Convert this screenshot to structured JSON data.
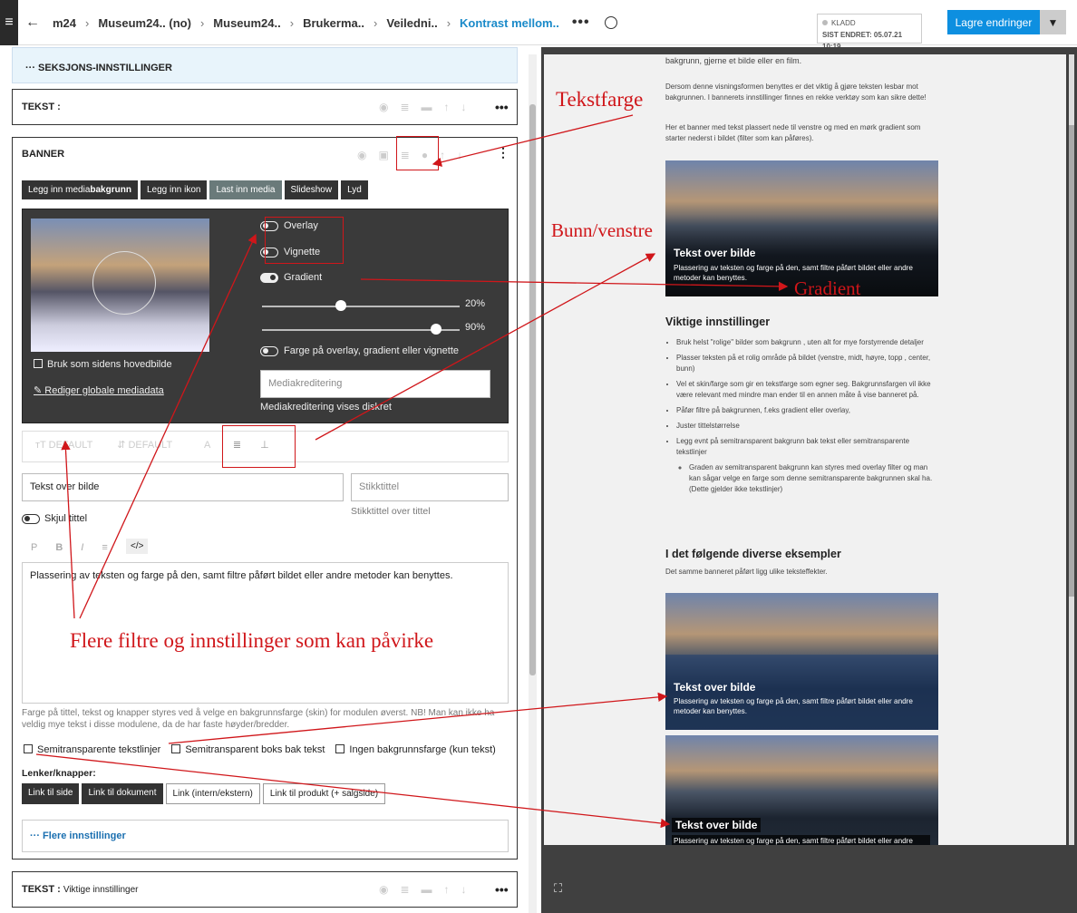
{
  "topbar": {
    "back": "←",
    "crumbs": [
      "m24",
      "Museum24.. (no)",
      "Museum24..",
      "Brukerma..",
      "Veiledni..",
      "Kontrast mellom.."
    ],
    "status": "KLADD",
    "last_changed": "SIST ENDRET: 05.07.21 10:19",
    "save": "Lagre endringer"
  },
  "section_settings": "··· SEKSJONS-INNSTILLINGER",
  "card1": {
    "title": "TEKST :"
  },
  "banner": {
    "title": "BANNER",
    "tabs": [
      {
        "pre": "Legg inn media",
        "bold": "bakgrunn"
      },
      {
        "label": "Legg inn ikon"
      },
      {
        "label": "Last inn media"
      },
      {
        "label": "Slideshow"
      },
      {
        "label": "Lyd"
      }
    ],
    "overlay": "Overlay",
    "vignette": "Vignette",
    "gradient": "Gradient",
    "pct1": "20%",
    "pct2": "90%",
    "slider1": 0.4,
    "slider2": 0.88,
    "color_toggle": "Farge på overlay, gradient eller vignette",
    "main_image": "Bruk som sidens hovedbilde",
    "edit_media": "Rediger globale mediadata",
    "credit_placeholder": "Mediakreditering",
    "credit_note": "Mediakreditering vises diskret",
    "default1": "DEFAULT",
    "default2": "DEFAULT",
    "title_value": "Tekst over bilde",
    "kicker_placeholder": "Stikktittel",
    "kicker_note": "Stikktittel over tittel",
    "hide_title": "Skjul tittel",
    "body_text": "Plassering av teksten og farge på den, samt filtre påført bildet eller andre metoder kan benyttes.",
    "help": "Farge på tittel, tekst og knapper styres ved å velge en bakgrunnsfarge (skin) for modulen øverst. NB! Man kan ikke ha veldig mye tekst i disse modulene, da de har faste høyder/bredder.",
    "cb1": "Semitransparente tekstlinjer",
    "cb2": "Semitransparent boks bak tekst",
    "cb3": "Ingen bakgrunnsfarge (kun tekst)",
    "links_label": "Lenker/knapper:",
    "links": [
      "Link til side",
      "Link til dokument",
      "Link (intern/ekstern)",
      "Link til produkt (+ salgside)"
    ],
    "more_settings": "··· Flere innstillinger"
  },
  "card3": {
    "title": "TEKST :",
    "subtitle": "Viktige innstillinger"
  },
  "preview": {
    "p0": "bakgrunn, gjerne et bilde eller en film.",
    "p1": "Dersom denne visningsformen benyttes er det viktig å gjøre teksten lesbar mot bakgrunnen. I bannerets innstillinger finnes en rekke verktøy som kan sikre dette!",
    "p2": "Her et banner med tekst plassert nede til venstre og med en mørk gradient som starter nederst i bildet (filter som kan påføres).",
    "banner_title": "Tekst over bilde",
    "banner_text": "Plassering av teksten og farge på den, samt filtre påført bildet eller andre metoder kan benyttes.",
    "h1": "Viktige innstillinger",
    "list": [
      "Bruk helst \"rolige\" bilder som bakgrunn , uten alt for mye forstyrrende detaljer",
      "Plasser teksten på et rolig område på bildet (venstre, midt, høyre, topp , center, bunn)",
      "Vel et skin/farge som gir en tekstfarge som egner seg. Bakgrunnsfargen vil ikke være relevant med mindre man ender til en annen måte å vise banneret på.",
      "Påfør filtre på bakgrunnen, f.eks gradient eller overlay,",
      "Juster tittelstørrelse",
      "Legg evnt på semitransparent bakgrunn bak tekst eller semitransparente tekstlinjer"
    ],
    "sublist": "Graden av semitransparent bakgrunn kan styres med overlay filter og man kan sågar velge en farge som denne semitransparente bakgrunnen skal ha. (Dette gjelder ikke tekstlinjer)",
    "h2": "I det følgende diverse eksempler",
    "p3": "Det samme banneret påført ligg ulike teksteffekter."
  },
  "annotations": {
    "tekstfarge": "Tekstfarge",
    "bunn": "Bunn/venstre",
    "gradient": "Gradient",
    "flere": "Flere filtre og innstillinger som kan påvirke"
  },
  "colors": {
    "accent": "#0d8fe0",
    "annotation": "#d0161a"
  }
}
